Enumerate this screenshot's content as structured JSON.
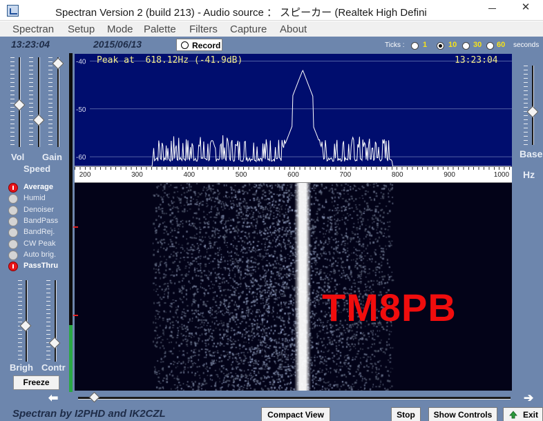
{
  "window": {
    "title": "Spectran Version 2  (build 213) - Audio source ： スピーカー (Realtek High Defini",
    "close_glyph": "✕"
  },
  "menu": [
    "Spectran",
    "Setup",
    "Mode",
    "Palette",
    "Filters",
    "Capture",
    "About"
  ],
  "header": {
    "clock": "13:23:04",
    "date": "2015/06/13",
    "record_label": "Record",
    "ticks_label": "Ticks :",
    "ticks_options": [
      "1",
      "10",
      "30",
      "60"
    ],
    "ticks_selected": "10",
    "seconds_label": "seconds"
  },
  "left_panel": {
    "vol_label": "Vol",
    "gain_label": "Gain",
    "speed_label": "Speed",
    "options": [
      {
        "label": "Average",
        "on": true
      },
      {
        "label": "Humid",
        "on": false
      },
      {
        "label": "Denoiser",
        "on": false
      },
      {
        "label": "BandPass",
        "on": false
      },
      {
        "label": "BandRej.",
        "on": false
      },
      {
        "label": "CW Peak",
        "on": false
      },
      {
        "label": "Auto brig.",
        "on": false
      },
      {
        "label": "PassThru",
        "on": true
      }
    ],
    "brigh_label": "Brigh",
    "contr_label": "Contr",
    "freeze_label": "Freeze"
  },
  "spectrum": {
    "peak_text": "Peak at  618.12Hz (-41.9dB)",
    "time": "13:23:04",
    "db_labels": [
      "-40",
      "-50",
      "-60"
    ],
    "peak_freq_hz": 618.12,
    "peak_db": -41.9
  },
  "axis": {
    "freq_labels": [
      "200",
      "300",
      "400",
      "500",
      "600",
      "700",
      "800",
      "900",
      "1000"
    ]
  },
  "waterfall": {
    "overlay_text": "TM8PB"
  },
  "right_panel": {
    "base_label": "Base",
    "hz_label": "Hz"
  },
  "footer": {
    "credit": "Spectran  by I2PHD and IK2CZL",
    "compact_view_label": "Compact View",
    "stop_label": "Stop",
    "show_controls_label": "Show Controls",
    "exit_label": "Exit",
    "left_arrow": "⬅",
    "right_arrow": "➔"
  },
  "colors": {
    "panel": "#6d86ad",
    "spectrum_bg": "#000d6e",
    "overlay": "#f00d0d",
    "ticks_value": "#f6e21a",
    "option_on": "#e8141a"
  }
}
